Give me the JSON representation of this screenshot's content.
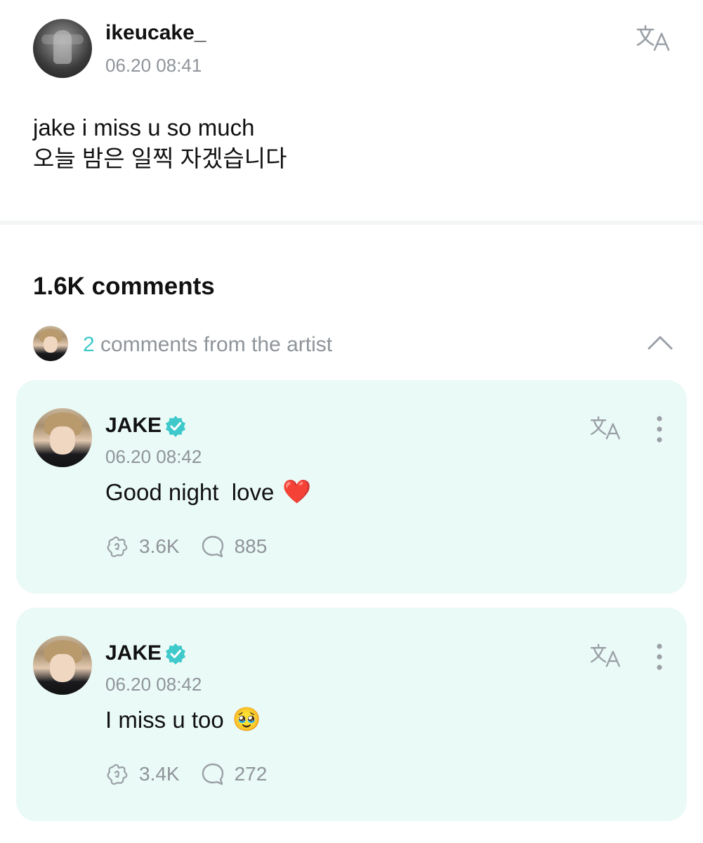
{
  "post": {
    "username": "ikeucake_",
    "timestamp": "06.20 08:41",
    "body_lines": [
      "jake i miss u so much",
      "오늘 밤은 일찍 자겠습니다"
    ]
  },
  "comments_header": {
    "count_label": "1.6K comments"
  },
  "artist_comments": {
    "count": "2",
    "label": "comments from the artist"
  },
  "comments": [
    {
      "author": "JAKE",
      "timestamp": "06.20 08:42",
      "text": "Good night  love",
      "emoji": "❤️",
      "likes": "3.6K",
      "replies": "885"
    },
    {
      "author": "JAKE",
      "timestamp": "06.20 08:42",
      "text": "I miss u too",
      "emoji": "🥹",
      "likes": "3.4K",
      "replies": "272"
    }
  ],
  "colors": {
    "accent": "#3fc9cb",
    "card_bg": "#eafaf7",
    "secondary_text": "#8f949a"
  },
  "icons": [
    "translate-icon",
    "verified-badge-icon",
    "more-options-icon",
    "cheer-icon",
    "reply-icon",
    "chevron-up-icon"
  ]
}
